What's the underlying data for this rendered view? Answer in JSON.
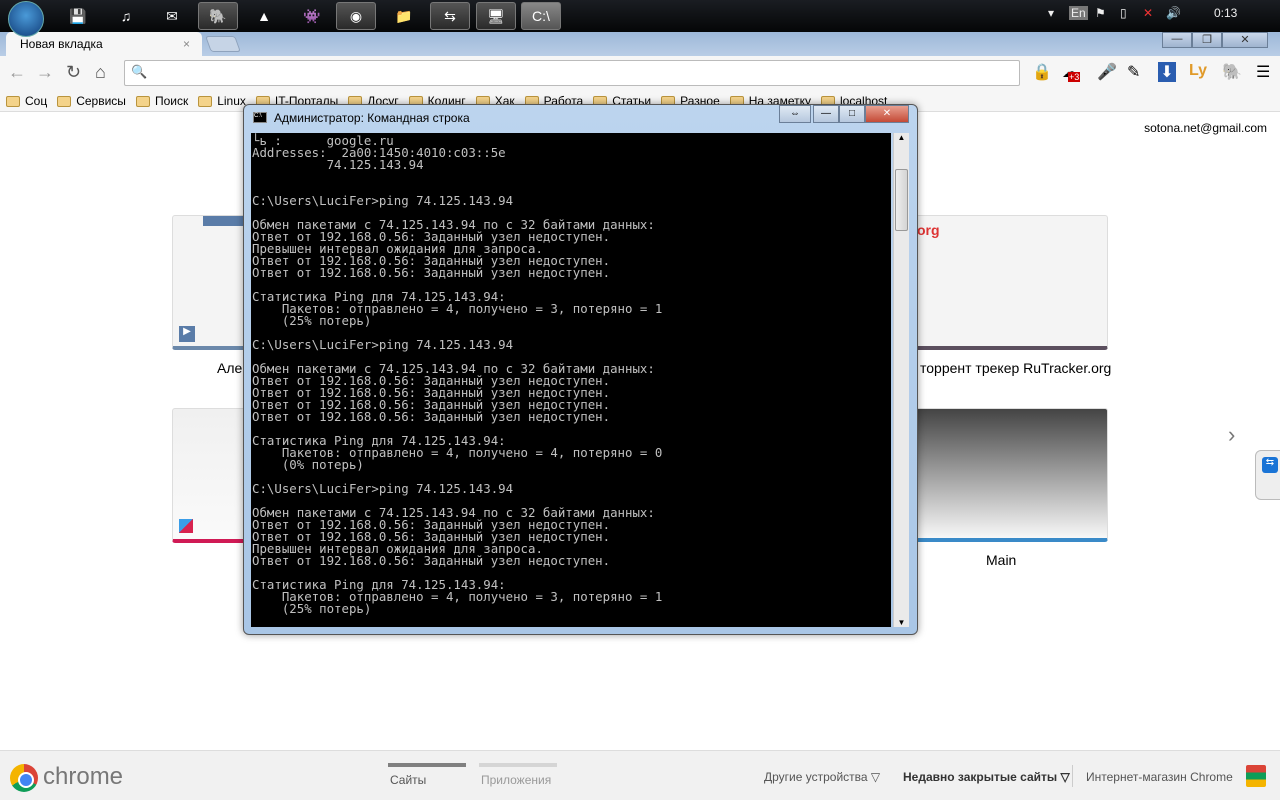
{
  "taskbar": {
    "apps": [
      "save-icon",
      "itunes-icon",
      "thunderbird-icon",
      "evernote-icon",
      "aimp-icon",
      "pidgin-icon",
      "chrome-icon",
      "explorer-icon",
      "teamviewer-icon",
      "remote-desktop-icon",
      "cmd-icon"
    ],
    "lang": "En",
    "clock": "0:13"
  },
  "browser": {
    "tab_title": "Новая вкладка",
    "tab_close": "×",
    "ext_badge": "+3",
    "ext_ly": "Ly",
    "bookmarks": [
      "Соц",
      "Сервисы",
      "Поиск",
      "Linux",
      "IT-Порталы",
      "Досуг",
      "Кодинг",
      "Хак",
      "Работа",
      "Статьи",
      "Разное",
      "На заметку",
      "localhost"
    ],
    "user_email": "sotona.net@gmail.com"
  },
  "ntp": {
    "thumbs": [
      {
        "label": "Але"
      },
      {
        "label": "торрент трекер RuTracker.org"
      },
      {
        "label": ""
      },
      {
        "label": "Main"
      }
    ],
    "next": "›"
  },
  "console": {
    "title": "Администратор: Командная строка",
    "lines": [
      "└ь :      google.ru",
      "Addresses:  2a00:1450:4010:c03::5e",
      "          74.125.143.94",
      "",
      "",
      "C:\\Users\\LuciFer>ping 74.125.143.94",
      "",
      "Обмен пакетами с 74.125.143.94 по с 32 байтами данных:",
      "Ответ от 192.168.0.56: Заданный узел недоступен.",
      "Превышен интервал ожидания для запроса.",
      "Ответ от 192.168.0.56: Заданный узел недоступен.",
      "Ответ от 192.168.0.56: Заданный узел недоступен.",
      "",
      "Статистика Ping для 74.125.143.94:",
      "    Пакетов: отправлено = 4, получено = 3, потеряно = 1",
      "    (25% потерь)",
      "",
      "C:\\Users\\LuciFer>ping 74.125.143.94",
      "",
      "Обмен пакетами с 74.125.143.94 по с 32 байтами данных:",
      "Ответ от 192.168.0.56: Заданный узел недоступен.",
      "Ответ от 192.168.0.56: Заданный узел недоступен.",
      "Ответ от 192.168.0.56: Заданный узел недоступен.",
      "Ответ от 192.168.0.56: Заданный узел недоступен.",
      "",
      "Статистика Ping для 74.125.143.94:",
      "    Пакетов: отправлено = 4, получено = 4, потеряно = 0",
      "    (0% потерь)",
      "",
      "C:\\Users\\LuciFer>ping 74.125.143.94",
      "",
      "Обмен пакетами с 74.125.143.94 по с 32 байтами данных:",
      "Ответ от 192.168.0.56: Заданный узел недоступен.",
      "Ответ от 192.168.0.56: Заданный узел недоступен.",
      "Превышен интервал ожидания для запроса.",
      "Ответ от 192.168.0.56: Заданный узел недоступен.",
      "",
      "Статистика Ping для 74.125.143.94:",
      "    Пакетов: отправлено = 4, получено = 3, потеряно = 1",
      "    (25% потерь)"
    ]
  },
  "footer": {
    "logo_text": "chrome",
    "tab_sites": "Сайты",
    "tab_apps": "Приложения",
    "other_devices": "Другие устройства ▽",
    "recently_closed": "Недавно закрытые сайты ▽",
    "webstore": "Интернет-магазин Chrome"
  }
}
